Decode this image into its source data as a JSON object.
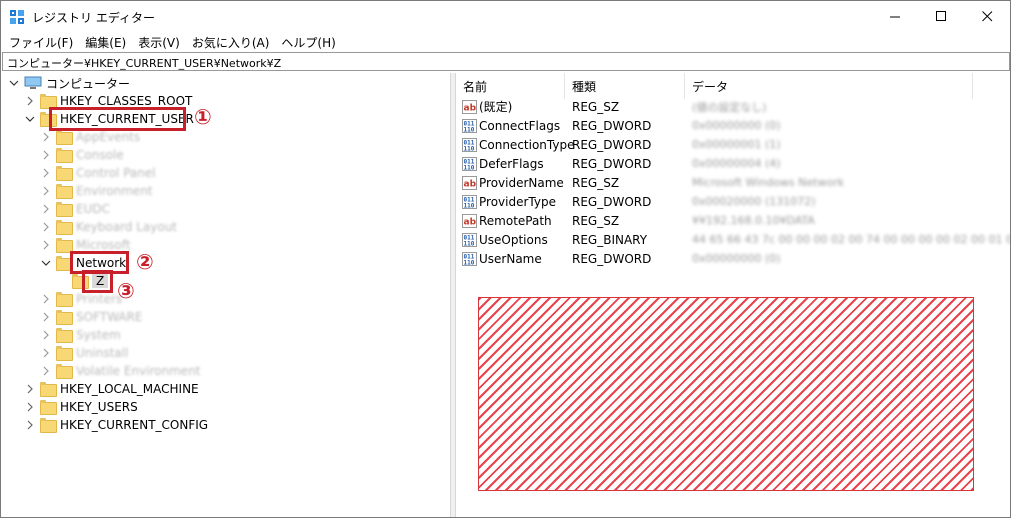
{
  "window": {
    "title": "レジストリ エディター"
  },
  "menu": [
    "ファイル(F)",
    "編集(E)",
    "表示(V)",
    "お気に入り(A)",
    "ヘルプ(H)"
  ],
  "address": "コンピューター¥HKEY_CURRENT_USER¥Network¥Z",
  "tree": {
    "root": "コンピューター",
    "hkcr": "HKEY_CLASSES_ROOT",
    "hkcu": "HKEY_CURRENT_USER",
    "hkcu_children_blurred": [
      "AppEvents",
      "Console",
      "Control Panel",
      "Environment",
      "EUDC",
      "Keyboard Layout",
      "Microsoft"
    ],
    "network": "Network",
    "z": "Z",
    "hkcu_children_blurred_after": [
      "Printers",
      "SOFTWARE",
      "System",
      "Uninstall",
      "Volatile Environment"
    ],
    "hklm": "HKEY_LOCAL_MACHINE",
    "hku": "HKEY_USERS",
    "hkcc": "HKEY_CURRENT_CONFIG"
  },
  "callouts": [
    "①",
    "②",
    "③"
  ],
  "columns": [
    "名前",
    "種類",
    "データ"
  ],
  "values": [
    {
      "icon": "string-value-icon",
      "name": "(既定)",
      "type": "REG_SZ",
      "data": "(値の設定なし)"
    },
    {
      "icon": "binary-value-icon",
      "name": "ConnectFlags",
      "type": "REG_DWORD",
      "data": "0x00000000 (0)"
    },
    {
      "icon": "binary-value-icon",
      "name": "ConnectionType",
      "type": "REG_DWORD",
      "data": "0x00000001 (1)"
    },
    {
      "icon": "binary-value-icon",
      "name": "DeferFlags",
      "type": "REG_DWORD",
      "data": "0x00000004 (4)"
    },
    {
      "icon": "string-value-icon",
      "name": "ProviderName",
      "type": "REG_SZ",
      "data": "Microsoft Windows Network"
    },
    {
      "icon": "binary-value-icon",
      "name": "ProviderType",
      "type": "REG_DWORD",
      "data": "0x00020000 (131072)"
    },
    {
      "icon": "string-value-icon",
      "name": "RemotePath",
      "type": "REG_SZ",
      "data": "¥¥192.168.0.10¥DATA"
    },
    {
      "icon": "binary-value-icon",
      "name": "UseOptions",
      "type": "REG_BINARY",
      "data": "44 65 66 43 7c 00 00 00 02 00 74 00 00 00 00 02 00 01 00..."
    },
    {
      "icon": "binary-value-icon",
      "name": "UserName",
      "type": "REG_DWORD",
      "data": "0x00000000 (0)"
    }
  ],
  "colors": {
    "highlight": "#c8202a",
    "redact": "#e8424c",
    "folder": "#f8d775"
  }
}
